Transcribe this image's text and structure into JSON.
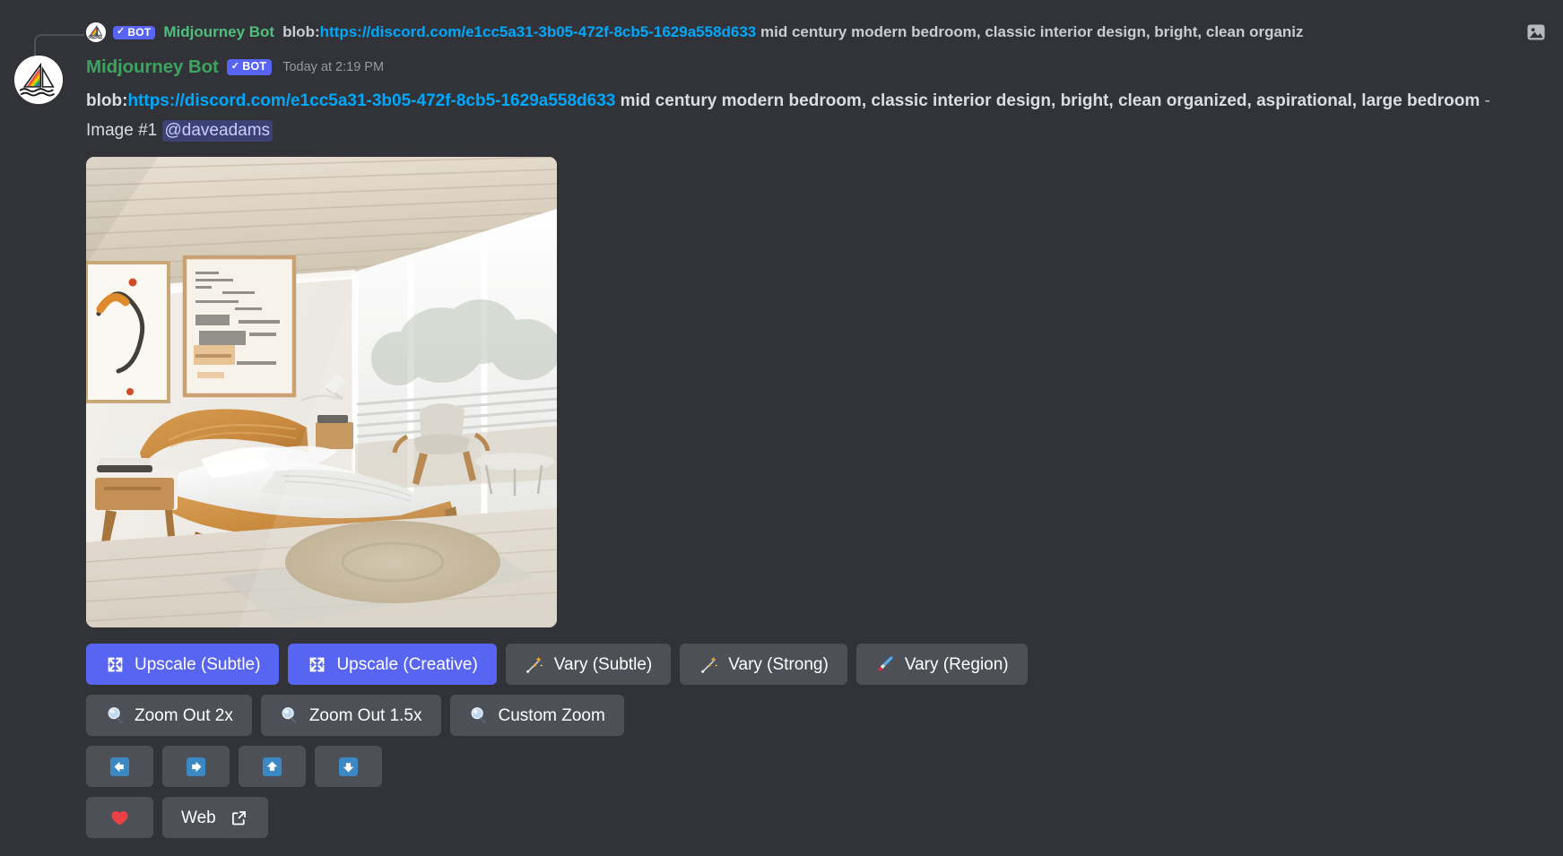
{
  "reply": {
    "bot_badge": "BOT",
    "bot_check": "✓",
    "author": "Midjourney Bot",
    "prefix": "blob:",
    "link": "https://discord.com/e1cc5a31-3b05-472f-8cb5-1629a558d633",
    "text": " mid century modern bedroom, classic interior design, bright, clean organiz",
    "attachment_icon": "image-icon",
    "avatar_icon": "midjourney-sailboat-logo"
  },
  "message": {
    "author": "Midjourney Bot",
    "bot_badge": "BOT",
    "bot_check": "✓",
    "timestamp": "Today at 2:19 PM",
    "avatar_icon": "midjourney-sailboat-logo",
    "body": {
      "prefix": "blob:",
      "link": "https://discord.com/e1cc5a31-3b05-472f-8cb5-1629a558d633",
      "prompt": " mid century modern bedroom, classic interior design, bright, clean organized, aspirational, large bedroom",
      "separator": " - ",
      "image_number": "Image #1",
      "mention": "@daveadams"
    },
    "attachment": {
      "alt": "mid century modern bedroom with wooden platform bed, floor to ceiling windows, round jute rug and framed art",
      "width": "525",
      "height": "525"
    }
  },
  "components": {
    "row1": [
      {
        "label": "Upscale (Subtle)",
        "icon": "expand-arrows-icon",
        "style": "primary"
      },
      {
        "label": "Upscale (Creative)",
        "icon": "expand-arrows-icon",
        "style": "primary"
      },
      {
        "label": "Vary (Subtle)",
        "icon": "magic-wand-icon",
        "style": "secondary"
      },
      {
        "label": "Vary (Strong)",
        "icon": "magic-wand-icon",
        "style": "secondary"
      },
      {
        "label": "Vary (Region)",
        "icon": "paintbrush-icon",
        "style": "secondary"
      }
    ],
    "row2": [
      {
        "label": "Zoom Out 2x",
        "icon": "magnifying-glass-icon",
        "style": "secondary"
      },
      {
        "label": "Zoom Out 1.5x",
        "icon": "magnifying-glass-icon",
        "style": "secondary"
      },
      {
        "label": "Custom Zoom",
        "icon": "magnifying-glass-icon",
        "style": "secondary"
      }
    ],
    "row3": [
      {
        "label": "",
        "icon": "arrow-left-icon",
        "style": "secondary"
      },
      {
        "label": "",
        "icon": "arrow-right-icon",
        "style": "secondary"
      },
      {
        "label": "",
        "icon": "arrow-up-icon",
        "style": "secondary"
      },
      {
        "label": "",
        "icon": "arrow-down-icon",
        "style": "secondary"
      }
    ],
    "row4": [
      {
        "label": "",
        "icon": "heart-icon",
        "style": "secondary"
      },
      {
        "label": "Web",
        "icon": "",
        "trailing_icon": "external-link-icon",
        "style": "secondary"
      }
    ]
  },
  "colors": {
    "background": "#313338",
    "primary_button": "#5865f2",
    "secondary_button": "#4e5058",
    "link": "#00a8fc",
    "author_green": "#3ba55d",
    "mention_bg": "#5865f2",
    "heart_red": "#ed4245",
    "arrow_blue": "#3b88c3"
  }
}
